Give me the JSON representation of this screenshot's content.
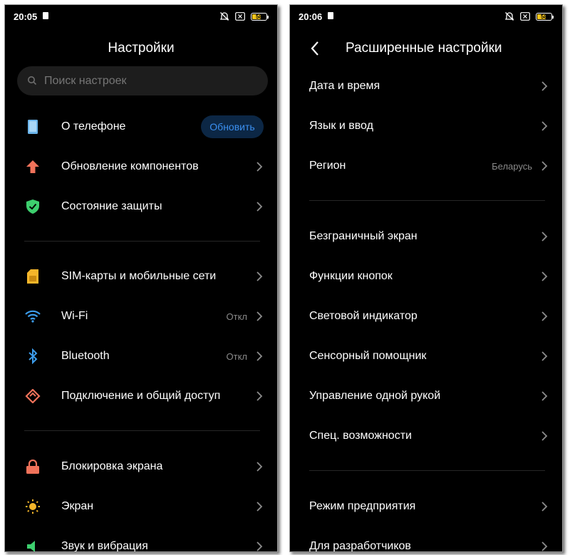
{
  "left": {
    "status": {
      "time": "20:05",
      "battery": "58"
    },
    "title": "Настройки",
    "search": {
      "placeholder": "Поиск настроек"
    },
    "items": [
      {
        "label": "О телефоне",
        "action": "Обновить"
      },
      {
        "label": "Обновление компонентов"
      },
      {
        "label": "Состояние защиты"
      },
      {
        "label": "SIM-карты и мобильные сети"
      },
      {
        "label": "Wi-Fi",
        "value": "Откл"
      },
      {
        "label": "Bluetooth",
        "value": "Откл"
      },
      {
        "label": "Подключение и общий доступ"
      },
      {
        "label": "Блокировка экрана"
      },
      {
        "label": "Экран"
      },
      {
        "label": "Звук и вибрация"
      }
    ]
  },
  "right": {
    "status": {
      "time": "20:06",
      "battery": "58"
    },
    "title": "Расширенные настройки",
    "items": [
      {
        "label": "Дата и время"
      },
      {
        "label": "Язык и ввод"
      },
      {
        "label": "Регион",
        "value": "Беларусь"
      },
      {
        "label": "Безграничный экран"
      },
      {
        "label": "Функции кнопок"
      },
      {
        "label": "Световой индикатор"
      },
      {
        "label": "Сенсорный помощник"
      },
      {
        "label": "Управление одной рукой"
      },
      {
        "label": "Спец. возможности"
      },
      {
        "label": "Режим предприятия"
      },
      {
        "label": "Для разработчиков"
      }
    ]
  },
  "colors": {
    "background": "#000000",
    "text": "#ffffff",
    "secondary_text": "#8a8a8a",
    "accent": "#3b8ff0",
    "update_button_bg": "#0c2745",
    "battery": "#f5c518"
  },
  "icons": {
    "about_phone": "phone-icon",
    "components": "arrow-up-icon",
    "security": "shield-check-icon",
    "sim": "sim-card-icon",
    "wifi": "wifi-icon",
    "bluetooth": "bluetooth-icon",
    "connection": "share-icon",
    "lock": "lock-icon",
    "display": "sun-icon",
    "sound": "speaker-icon",
    "chevron": "chevron-right-icon",
    "back": "back-arrow-icon"
  }
}
